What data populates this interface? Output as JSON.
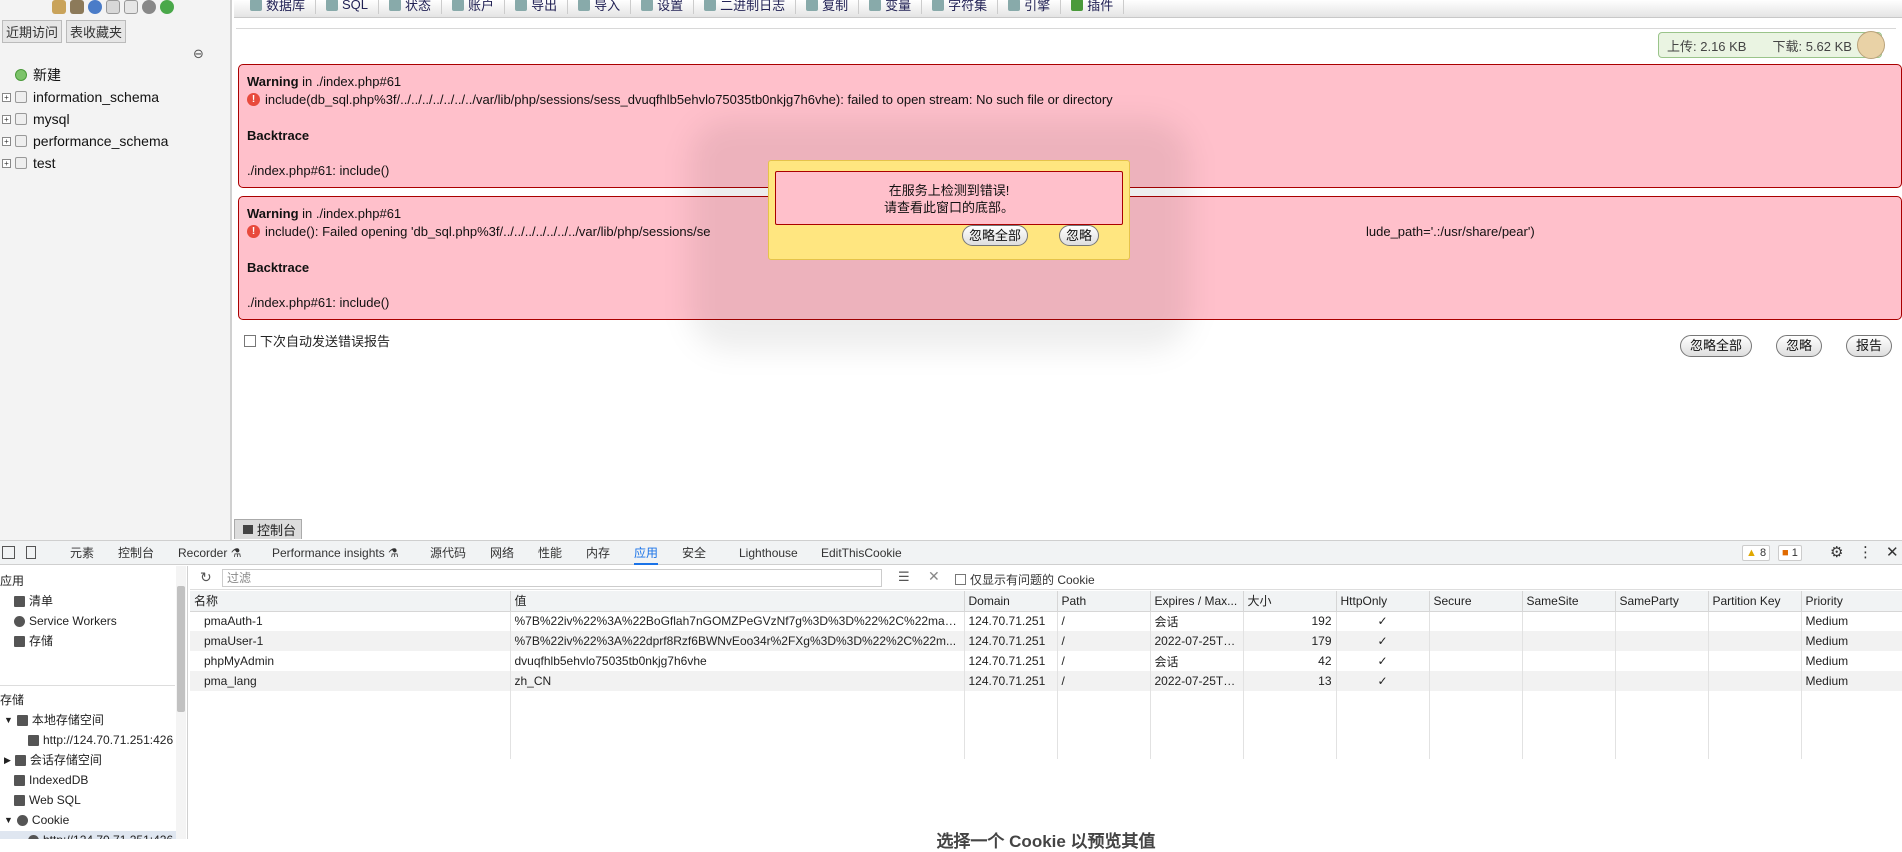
{
  "nav": {
    "tabs": [
      "近期访问",
      "表收藏夹"
    ],
    "new_label": "新建",
    "databases": [
      "information_schema",
      "mysql",
      "performance_schema",
      "test"
    ]
  },
  "topmenu": {
    "items": [
      "数据库",
      "SQL",
      "状态",
      "账户",
      "导出",
      "导入",
      "设置",
      "二进制日志",
      "复制",
      "变量",
      "字符集",
      "引擎",
      "插件"
    ]
  },
  "traffic": {
    "upload": "上传: 2.16 KB",
    "download": "下载: 5.62 KB"
  },
  "errors": [
    {
      "level": "Warning",
      "in_text": " in ./index.php#61",
      "message": "include(db_sql.php%3f/../../../../../../../var/lib/php/sessions/sess_dvuqfhlb5ehvlo75035tb0nkjg7h6vhe): failed to open stream: No such file or directory",
      "backtrace_title": "Backtrace",
      "frame": "./index.php#61: include()"
    },
    {
      "level": "Warning",
      "in_text": " in ./index.php#61",
      "message": "include(): Failed opening 'db_sql.php%3f/../../../../../../../var/lib/php/sessions/se",
      "message_tail": "lude_path='.:/usr/share/pear')",
      "backtrace_title": "Backtrace",
      "frame": "./index.php#61: include()"
    }
  ],
  "autosend_label": "下次自动发送错误报告",
  "buttons": {
    "ignore_all": "忽略全部",
    "ignore": "忽略",
    "report": "报告"
  },
  "popup": {
    "line1": "在服务上检测到错误!",
    "line2": "请查看此窗口的底部。",
    "ignore_all": "忽略全部",
    "ignore": "忽略"
  },
  "console_tab": "控制台",
  "devtools": {
    "tabs": [
      "元素",
      "控制台",
      "Recorder ⚗",
      "Performance insights ⚗",
      "源代码",
      "网络",
      "性能",
      "内存",
      "应用",
      "安全",
      "Lighthouse",
      "EditThisCookie"
    ],
    "active_tab": "应用",
    "warn_count": "8",
    "info_count": "1",
    "sidebar": {
      "app_title": "应用",
      "app_items": [
        "清单",
        "Service Workers",
        "存储"
      ],
      "storage_title": "存储",
      "storage_items": [
        {
          "label": "本地存储空间",
          "expanded": true
        },
        {
          "label": "http://124.70.71.251:426",
          "child": true
        },
        {
          "label": "会话存储空间",
          "expanded": false
        },
        {
          "label": "IndexedDB"
        },
        {
          "label": "Web SQL"
        },
        {
          "label": "Cookie",
          "expanded": true
        },
        {
          "label": "http://124.70.71.251:426",
          "child": true,
          "selected": true
        }
      ]
    },
    "filter_placeholder": "过滤",
    "only_issues_label": "仅显示有问题的 Cookie",
    "columns": [
      "名称",
      "值",
      "Domain",
      "Path",
      "Expires / Max...",
      "大小",
      "HttpOnly",
      "Secure",
      "SameSite",
      "SameParty",
      "Partition Key",
      "Priority"
    ],
    "cookies": [
      [
        "pmaAuth-1",
        "%7B%22iv%22%3A%22BoGflah7nGOMZPeGVzNf7g%3D%3D%22%2C%22mac%2...",
        "124.70.71.251",
        "/",
        "会话",
        "192",
        "✓",
        "",
        "",
        "",
        "",
        "Medium"
      ],
      [
        "pmaUser-1",
        "%7B%22iv%22%3A%22dprf8Rzf6BWNvEoo34r%2FXg%3D%3D%22%2C%22m...",
        "124.70.71.251",
        "/",
        "2022-07-25T1...",
        "179",
        "✓",
        "",
        "",
        "",
        "",
        "Medium"
      ],
      [
        "phpMyAdmin",
        "dvuqfhlb5ehvlo75035tb0nkjg7h6vhe",
        "124.70.71.251",
        "/",
        "会话",
        "42",
        "✓",
        "",
        "",
        "",
        "",
        "Medium"
      ],
      [
        "pma_lang",
        "zh_CN",
        "124.70.71.251",
        "/",
        "2022-07-25T1...",
        "13",
        "✓",
        "",
        "",
        "",
        "",
        "Medium"
      ]
    ],
    "preview_message": "选择一个 Cookie 以预览其值"
  }
}
